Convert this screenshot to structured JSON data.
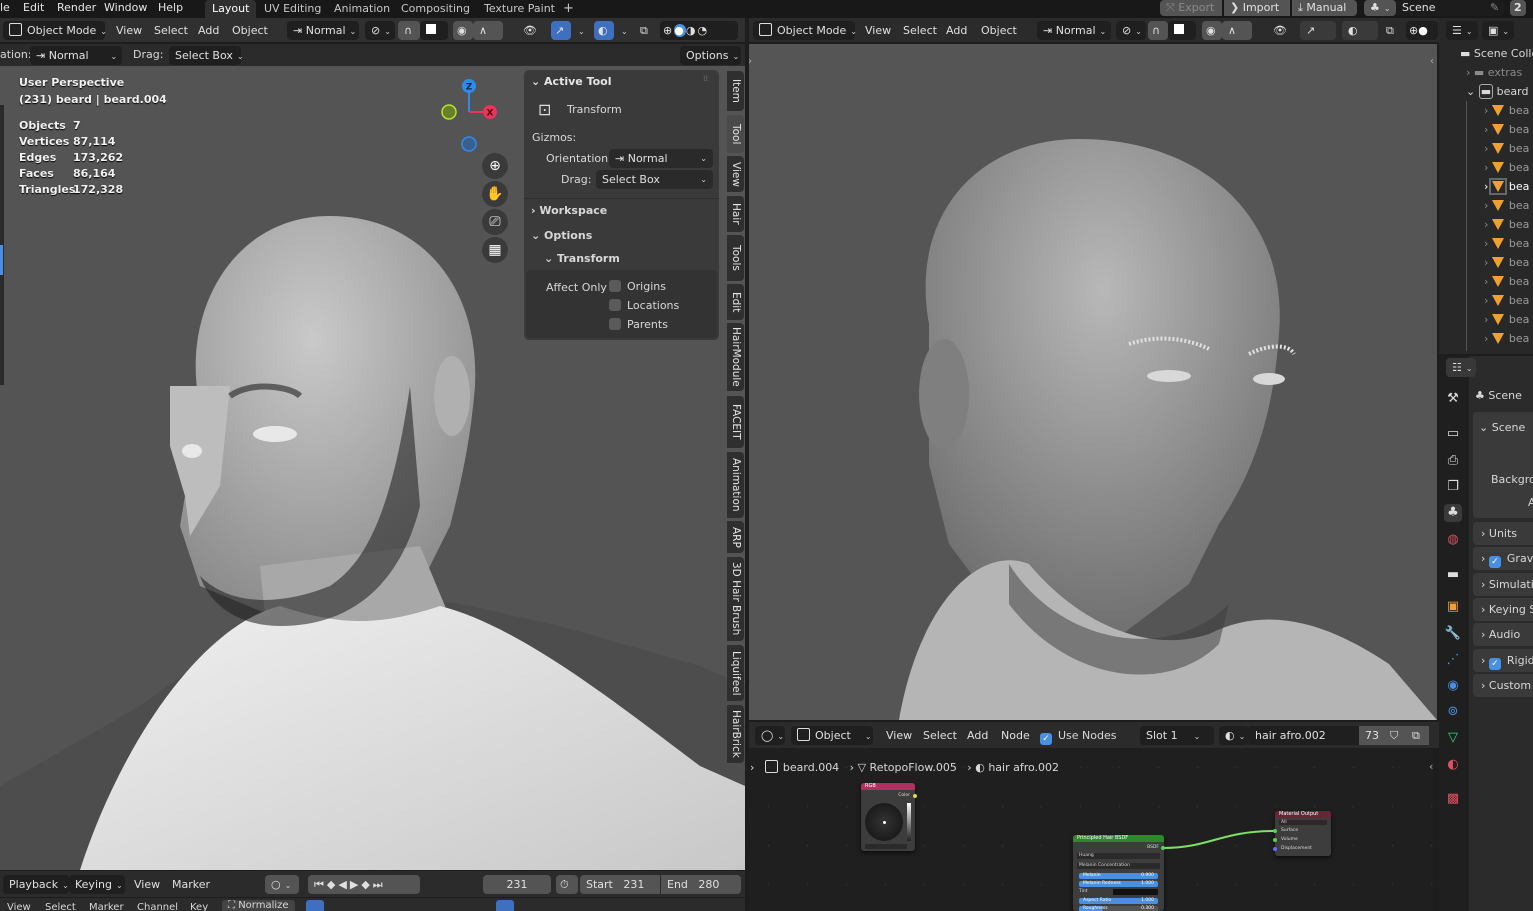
{
  "topbar": {
    "menu": [
      "le",
      "Edit",
      "Render",
      "Window",
      "Help"
    ],
    "workspace_tabs": [
      {
        "label": "Layout",
        "active": true
      },
      {
        "label": "UV Editing",
        "active": false
      },
      {
        "label": "Animation",
        "active": false
      },
      {
        "label": "Compositing",
        "active": false
      },
      {
        "label": "Texture Paint",
        "active": false
      }
    ],
    "add_tab": "+",
    "right_buttons": [
      "Export",
      "Import",
      "Manual"
    ],
    "scene_name": "Scene",
    "view_layer_count": "2"
  },
  "left_viewport": {
    "header": {
      "mode": "Object Mode",
      "menus": [
        "View",
        "Select",
        "Add",
        "Object"
      ],
      "orientation": "Normal"
    },
    "toolbar2": {
      "orientation_label": "ation:",
      "orientation_value": "Normal",
      "drag_label": "Drag:",
      "drag_value": "Select Box",
      "options_label": "Options"
    },
    "overlay": {
      "view_name": "User Perspective",
      "object_info": "(231) beard | beard.004",
      "stats": [
        {
          "label": "Objects",
          "value": "7"
        },
        {
          "label": "Vertices",
          "value": "87,114"
        },
        {
          "label": "Edges",
          "value": "173,262"
        },
        {
          "label": "Faces",
          "value": "86,164"
        },
        {
          "label": "Triangles",
          "value": "172,328"
        }
      ]
    },
    "gizmo_axes": {
      "z": "Z",
      "x": "X"
    },
    "sidebar_panel": {
      "active_tool_title": "Active Tool",
      "tool_name": "Transform",
      "gizmos_label": "Gizmos:",
      "orientation_label": "Orientation",
      "orientation_value": "Normal",
      "drag_label": "Drag:",
      "drag_value": "Select Box",
      "workspace_title": "Workspace",
      "options_title": "Options",
      "transform_title": "Transform",
      "affect_only_label": "Affect Only",
      "affect_only": [
        {
          "label": "Origins",
          "checked": false
        },
        {
          "label": "Locations",
          "checked": false
        },
        {
          "label": "Parents",
          "checked": false
        }
      ]
    },
    "sidebar_tabs": [
      "Item",
      "Tool",
      "View",
      "Hair",
      "Tools",
      "Edit",
      "HairModule",
      "FACEIT",
      "Animation",
      "ARP",
      "3D Hair Brush",
      "Liquifeel",
      "HairBrick"
    ],
    "active_sidebar_tab": "Tool"
  },
  "right_viewport": {
    "header": {
      "mode": "Object Mode",
      "menus": [
        "View",
        "Select",
        "Add",
        "Object"
      ],
      "orientation": "Normal"
    }
  },
  "outliner": {
    "root": "Scene Colle",
    "collections": [
      {
        "name": "extras",
        "expanded": false
      },
      {
        "name": "beard",
        "expanded": true
      }
    ],
    "child_items": [
      "bea",
      "bea",
      "bea",
      "bea",
      "bea",
      "bea",
      "bea",
      "bea",
      "bea",
      "bea",
      "bea",
      "bea",
      "bea"
    ],
    "active_child_index": 4
  },
  "properties": {
    "context_title": "Scene",
    "scene_panel_title": "Scene",
    "scene_fields": [
      "Backgrou",
      "A"
    ],
    "panels": [
      {
        "label": "Units",
        "checkbox": false
      },
      {
        "label": "Gravit",
        "checkbox": true
      },
      {
        "label": "Simulati",
        "checkbox": false
      },
      {
        "label": "Keying S",
        "checkbox": false
      },
      {
        "label": "Audio",
        "checkbox": false
      },
      {
        "label": "Rigid",
        "checkbox": true
      },
      {
        "label": "Custom",
        "checkbox": false
      }
    ],
    "tab_icons": [
      "tool-icon",
      "render-icon",
      "output-icon",
      "view-layer-icon",
      "scene-icon",
      "world-icon",
      "collection-icon",
      "object-icon",
      "modifier-icon",
      "particles-icon",
      "physics-icon",
      "constraints-icon",
      "data-icon",
      "material-icon",
      "texture-icon"
    ]
  },
  "node_editor": {
    "header": {
      "type": "Object",
      "menus": [
        "View",
        "Select",
        "Add",
        "Node"
      ],
      "use_nodes_label": "Use Nodes",
      "use_nodes": true,
      "slot": "Slot 1",
      "material": "hair afro.002",
      "users": "73"
    },
    "breadcrumb": [
      "beard.004",
      "RetopoFlow.005",
      "hair afro.002"
    ],
    "nodes": {
      "rgb": {
        "title": "RGB",
        "output": "Color"
      },
      "hair_bsdf": {
        "title": "Principled Hair BSDF",
        "output": "BSDF",
        "model": "Huang",
        "parametrization": "Melanin Concentration",
        "fields": [
          {
            "label": "Melanin",
            "value": "0.900",
            "fill": 0.9
          },
          {
            "label": "Melanin Redness",
            "value": "1.000",
            "fill": 1.0
          },
          {
            "label": "Tint",
            "value": ""
          },
          {
            "label": "Aspect Ratio",
            "value": "1.000",
            "fill": 1.0
          },
          {
            "label": "Roughness",
            "value": "0.300",
            "fill": 0.3
          }
        ]
      },
      "material_output": {
        "title": "Material Output",
        "target": "All",
        "inputs": [
          "Surface",
          "Volume",
          "Displacement"
        ]
      }
    }
  },
  "timeline": {
    "menus": [
      "Playback",
      "Keying",
      "View",
      "Marker"
    ],
    "current_frame": "231",
    "start_label": "Start",
    "start": "231",
    "end_label": "End",
    "end": "280"
  },
  "graph_header": {
    "menus": [
      "View",
      "Select",
      "Marker",
      "Channel",
      "Key"
    ],
    "normalize_label": "Normalize"
  },
  "colors": {
    "accent": "#4a90e2",
    "x_axis": "#f0325a",
    "y_axis": "#8bc000",
    "z_axis": "#2d8ceb",
    "node_green": "#2b8a2b",
    "node_pink": "#b03060",
    "link_green": "#7ee060"
  }
}
